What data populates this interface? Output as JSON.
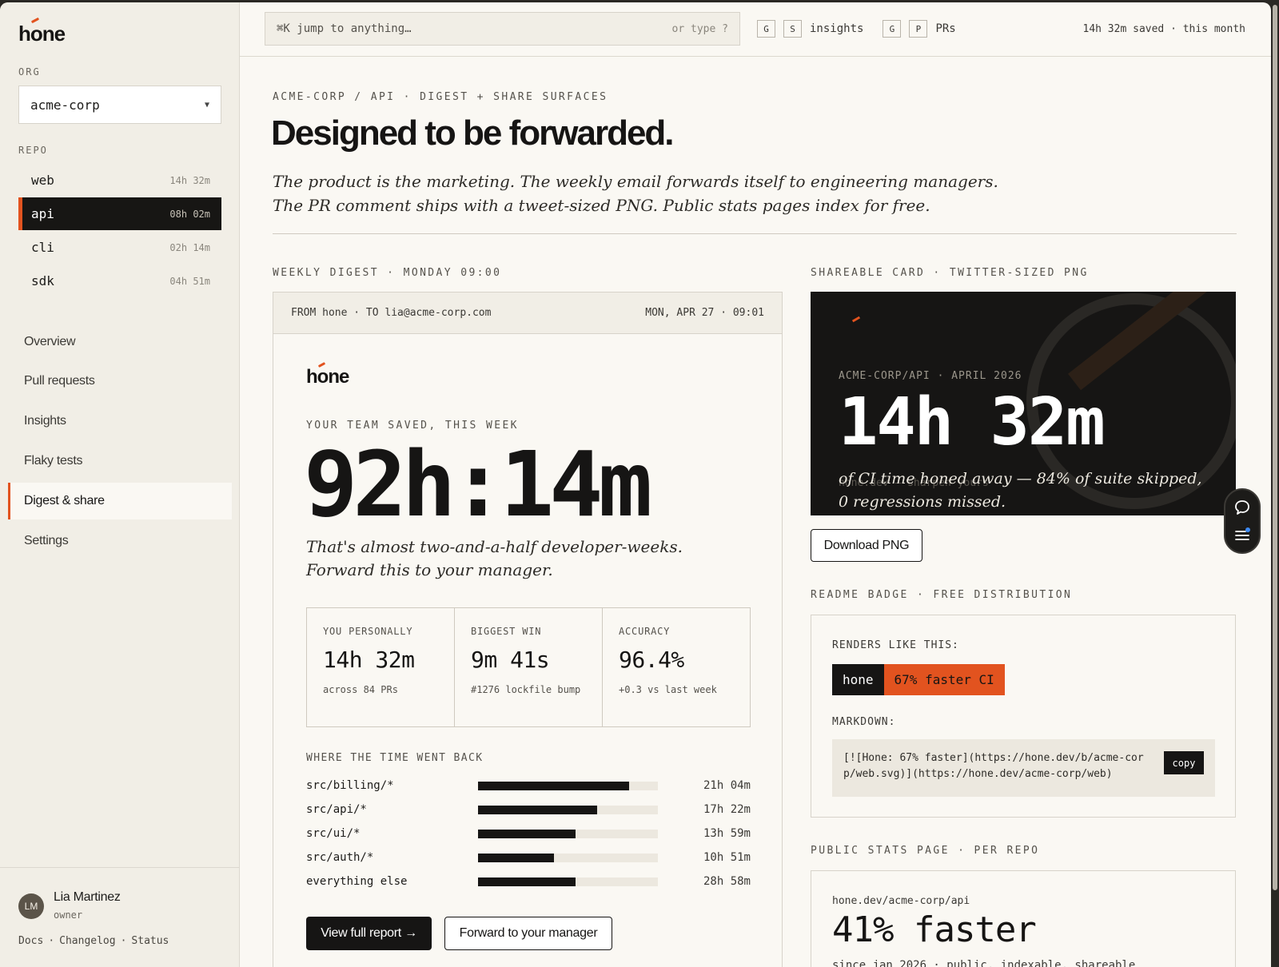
{
  "app": {
    "logo_text": "hone"
  },
  "sidebar": {
    "org_label": "ORG",
    "org_selected": "acme-corp",
    "repo_label": "REPO",
    "repos": [
      {
        "name": "web",
        "time": "14h 32m"
      },
      {
        "name": "api",
        "time": "08h 02m",
        "active": true
      },
      {
        "name": "cli",
        "time": "02h 14m"
      },
      {
        "name": "sdk",
        "time": "04h 51m"
      }
    ],
    "nav": [
      {
        "label": "Overview"
      },
      {
        "label": "Pull requests"
      },
      {
        "label": "Insights"
      },
      {
        "label": "Flaky tests"
      },
      {
        "label": "Digest & share",
        "active": true
      },
      {
        "label": "Settings"
      }
    ],
    "user": {
      "initials": "LM",
      "name": "Lia Martinez",
      "role": "owner"
    },
    "footer_links": [
      "Docs",
      "·",
      "Changelog",
      "·",
      "Status"
    ]
  },
  "topbar": {
    "search_placeholder": "⌘K  jump to anything…",
    "search_hint": "or type ?",
    "shortcuts": [
      {
        "keys": [
          "G",
          "S"
        ],
        "label": "insights"
      },
      {
        "keys": [
          "G",
          "P"
        ],
        "label": "PRs"
      }
    ],
    "saved_summary": "14h 32m saved · this month"
  },
  "main": {
    "breadcrumb": "ACME-CORP / API · DIGEST + SHARE SURFACES",
    "title": "Designed to be forwarded.",
    "subtitle": "The product is the marketing. The weekly email forwards itself to engineering managers. The PR comment ships with a tweet-sized PNG. Public stats pages index for free."
  },
  "digest": {
    "section_label": "WEEKLY DIGEST · MONDAY 09:00",
    "from_to": "FROM hone · TO lia@acme-corp.com",
    "date": "MON, APR 27 · 09:01",
    "logo_text": "hone",
    "kicker": "YOUR TEAM SAVED, THIS WEEK",
    "big_time": "92h:14m",
    "blurb": "That's almost two-and-a-half developer-weeks. Forward this to your manager.",
    "stats": [
      {
        "label": "YOU PERSONALLY",
        "value": "14h 32m",
        "note": "across 84 PRs"
      },
      {
        "label": "BIGGEST WIN",
        "value": "9m 41s",
        "note": "#1276 lockfile bump"
      },
      {
        "label": "ACCURACY",
        "value": "96.4%",
        "note": "+0.3 vs last week"
      }
    ],
    "time_went_label": "WHERE THE TIME WENT BACK",
    "breakdown": [
      {
        "path": "src/billing/*",
        "time": "21h 04m",
        "fraction": 0.84
      },
      {
        "path": "src/api/*",
        "time": "17h 22m",
        "fraction": 0.66
      },
      {
        "path": "src/ui/*",
        "time": "13h 59m",
        "fraction": 0.54
      },
      {
        "path": "src/auth/*",
        "time": "10h 51m",
        "fraction": 0.42
      },
      {
        "path": "everything else",
        "time": "28h 58m",
        "fraction": 0.54
      }
    ],
    "primary_button": "View full report →",
    "secondary_button": "Forward to your manager"
  },
  "share_card": {
    "section_label": "SHAREABLE CARD · TWITTER-SIZED PNG",
    "kicker": "ACME-CORP/API · APRIL 2026",
    "time": "14h 32m",
    "watermark": "hone.dev — sharpen yours",
    "caption": "of CI time honed away — 84% of suite skipped, 0 regressions missed.",
    "download_button": "Download PNG"
  },
  "badge": {
    "section_label": "README BADGE · FREE DISTRIBUTION",
    "renders_label": "RENDERS LIKE THIS:",
    "badge_left": "hone",
    "badge_right": "67% faster CI",
    "markdown_label": "MARKDOWN:",
    "markdown_code": "[![Hone: 67% faster](https://hone.dev/b/acme-corp/web.svg)](https://hone.dev/acme-corp/web)",
    "copy_button": "copy"
  },
  "public_page": {
    "section_label": "PUBLIC STATS PAGE · PER REPO",
    "url": "hone.dev/acme-corp/api",
    "headline": "41% faster",
    "since": "since jan 2026 · public, indexable, shareable"
  },
  "colors": {
    "accent": "#e2531f",
    "ink": "#161514",
    "paper": "#faf8f3",
    "sidebar": "#f1eee6"
  },
  "icons": {
    "float_top": "chat-bubble-icon",
    "float_bottom": "list-with-notification-icon"
  }
}
